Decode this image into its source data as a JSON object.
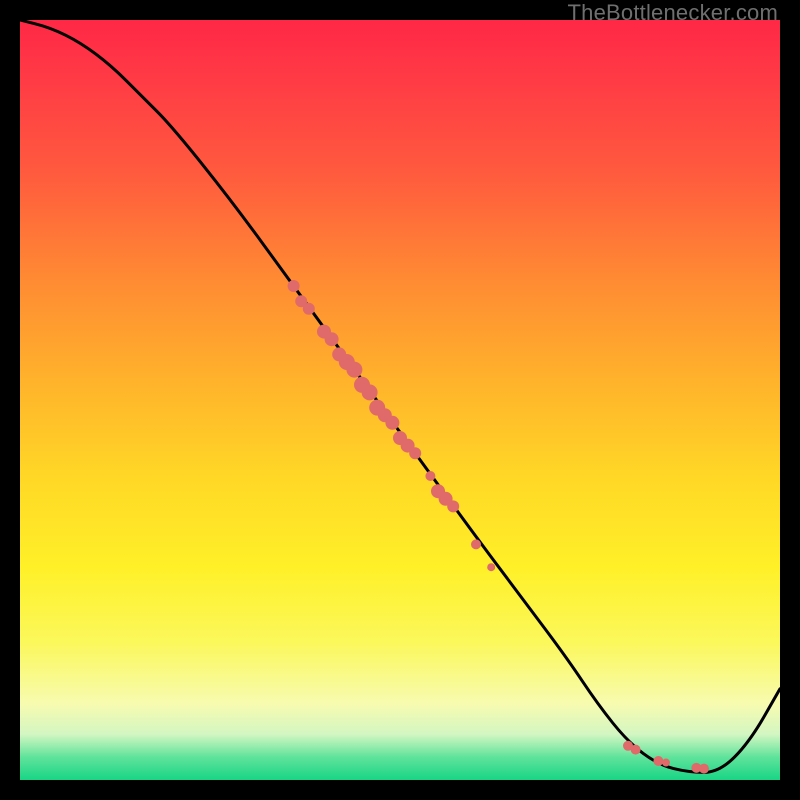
{
  "watermark": "TheBottlenecker.com",
  "chart_data": {
    "type": "line",
    "title": "",
    "xlabel": "",
    "ylabel": "",
    "xlim": [
      0,
      100
    ],
    "ylim": [
      0,
      100
    ],
    "grid": false,
    "series": [
      {
        "name": "curve",
        "x": [
          0,
          4,
          8,
          12,
          16,
          20,
          28,
          36,
          44,
          52,
          60,
          66,
          72,
          76,
          80,
          84,
          88,
          92,
          96,
          100
        ],
        "y": [
          100,
          99,
          97,
          94,
          90,
          86,
          76,
          65,
          54,
          43,
          32,
          24,
          16,
          10,
          5,
          2,
          1,
          1,
          5,
          12
        ]
      }
    ],
    "points": {
      "name": "highlighted-points",
      "color": "#e06a6a",
      "xy": [
        [
          36,
          65,
          6
        ],
        [
          37,
          63,
          6
        ],
        [
          38,
          62,
          6
        ],
        [
          40,
          59,
          7
        ],
        [
          41,
          58,
          7
        ],
        [
          42,
          56,
          7
        ],
        [
          43,
          55,
          8
        ],
        [
          44,
          54,
          8
        ],
        [
          45,
          52,
          8
        ],
        [
          46,
          51,
          8
        ],
        [
          47,
          49,
          8
        ],
        [
          48,
          48,
          7
        ],
        [
          49,
          47,
          7
        ],
        [
          50,
          45,
          7
        ],
        [
          51,
          44,
          7
        ],
        [
          52,
          43,
          6
        ],
        [
          54,
          40,
          5
        ],
        [
          55,
          38,
          7
        ],
        [
          56,
          37,
          7
        ],
        [
          57,
          36,
          6
        ],
        [
          60,
          31,
          5
        ],
        [
          62,
          28,
          4
        ],
        [
          80,
          4.5,
          5
        ],
        [
          81,
          4,
          5
        ],
        [
          84,
          2.5,
          5
        ],
        [
          85,
          2.3,
          4
        ],
        [
          89,
          1.6,
          5
        ],
        [
          90,
          1.5,
          5
        ]
      ]
    },
    "background_gradient": {
      "top": "#ff2846",
      "mid1": "#ffb42b",
      "mid2": "#fff028",
      "bottom": "#18d585"
    }
  }
}
